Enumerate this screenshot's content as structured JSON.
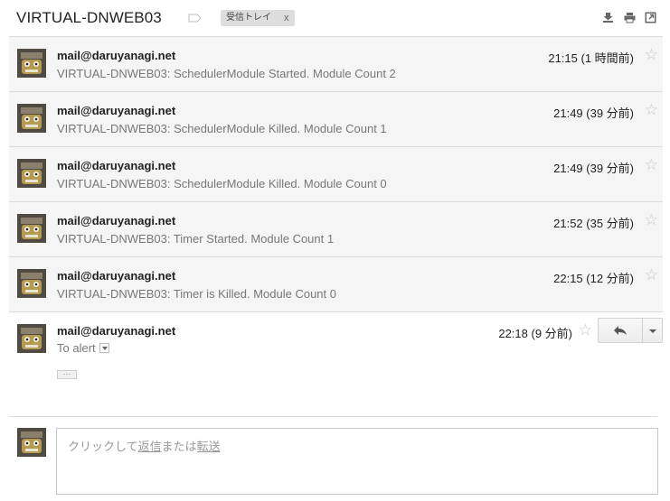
{
  "header": {
    "subject": "VIRTUAL-DNWEB03",
    "label_chip": "受信トレイ",
    "label_chip_close": "x",
    "icons": [
      "label-icon",
      "download-icon",
      "print-icon",
      "open-in-new-window-icon"
    ]
  },
  "messages": [
    {
      "from": "mail@daruyanagi.net",
      "snippet": "VIRTUAL-DNWEB03: SchedulerModule Started. Module Count 2",
      "time": "21:15 (1 時間前)"
    },
    {
      "from": "mail@daruyanagi.net",
      "snippet": "VIRTUAL-DNWEB03: SchedulerModule Killed. Module Count 1",
      "time": "21:49 (39 分前)"
    },
    {
      "from": "mail@daruyanagi.net",
      "snippet": "VIRTUAL-DNWEB03: SchedulerModule Killed. Module Count 0",
      "time": "21:49 (39 分前)"
    },
    {
      "from": "mail@daruyanagi.net",
      "snippet": "VIRTUAL-DNWEB03: Timer Started. Module Count 1",
      "time": "21:52 (35 分前)"
    },
    {
      "from": "mail@daruyanagi.net",
      "snippet": "VIRTUAL-DNWEB03: Timer is Killed. Module Count 0",
      "time": "22:15 (12 分前)"
    }
  ],
  "open_message": {
    "from": "mail@daruyanagi.net",
    "to": "To alert",
    "time": "22:18 (9 分前)",
    "ellipsis": "···",
    "reply_icon": "reply-arrow-icon",
    "more_icon": "chevron-down-icon"
  },
  "reply_box": {
    "prompt_prefix": "クリックして",
    "reply_link": "返信",
    "or_text": "または",
    "forward_link": "転送"
  },
  "colors": {
    "collapsed_bg": "#f5f5f5",
    "star": "#c6c6c6",
    "snippet": "#777777"
  }
}
